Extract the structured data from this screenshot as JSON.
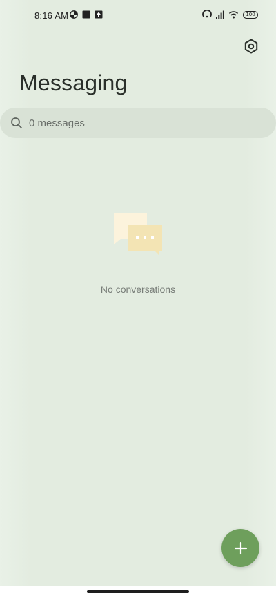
{
  "status_bar": {
    "time": "8:16 AM",
    "battery": "100",
    "left_icons": [
      "data-saver-icon",
      "square-notification-icon",
      "upload-notification-icon"
    ],
    "right_icons": [
      "hotspot-icon",
      "signal-icon",
      "wifi-icon",
      "battery-icon"
    ]
  },
  "header": {
    "title": "Messaging",
    "settings_icon": "settings-hexagon-icon"
  },
  "search": {
    "placeholder": "0 messages",
    "icon": "search-icon"
  },
  "empty_state": {
    "icon": "chat-bubbles-icon",
    "text": "No conversations"
  },
  "fab": {
    "icon": "plus-icon",
    "color": "#6e9f5c"
  },
  "colors": {
    "background": "#e3ece0",
    "search_bg": "#d9e2d6",
    "accent": "#6e9f5c",
    "bubble_back": "#fcf3dc",
    "bubble_front": "#f3e4b4"
  }
}
